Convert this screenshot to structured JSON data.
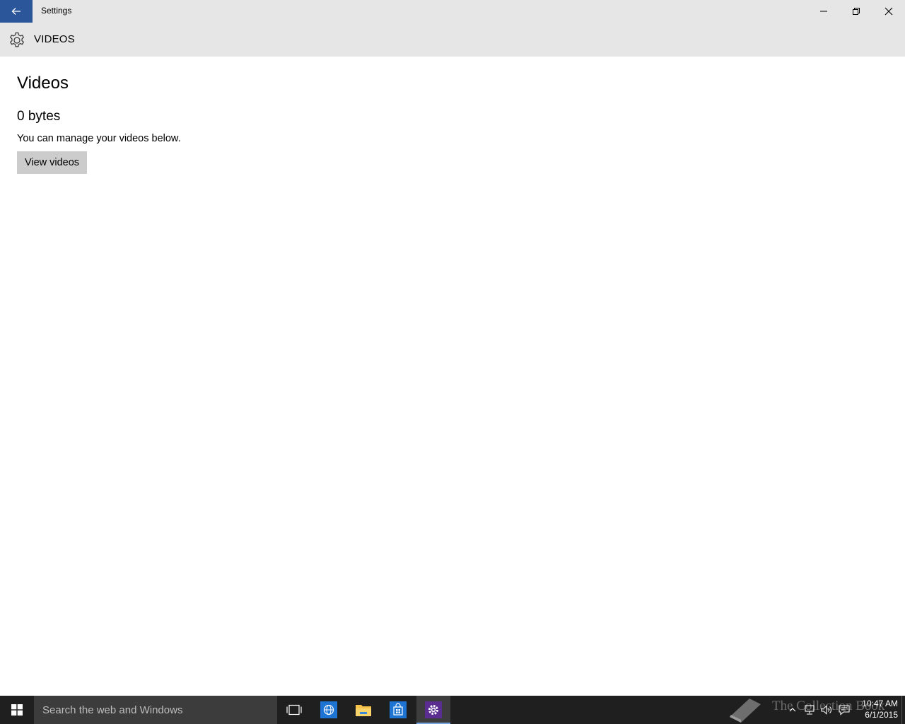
{
  "window": {
    "title": "Settings",
    "header_title": "VIDEOS"
  },
  "content": {
    "page_title": "Videos",
    "size_value": "0 bytes",
    "description": "You can manage your videos below.",
    "view_button_label": "View videos"
  },
  "taskbar": {
    "search_placeholder": "Search the web and Windows",
    "watermark": "The Collection Book",
    "clock_time": "10:47 AM",
    "clock_date": "6/1/2015",
    "apps": [
      "task-view-icon",
      "internet-explorer-icon",
      "file-explorer-icon",
      "store-icon",
      "settings-icon"
    ]
  },
  "colors": {
    "accent": "#2b579a",
    "titlebar": "#e6e6e6",
    "taskbar": "#1f1f1f",
    "button": "#cccccc"
  }
}
